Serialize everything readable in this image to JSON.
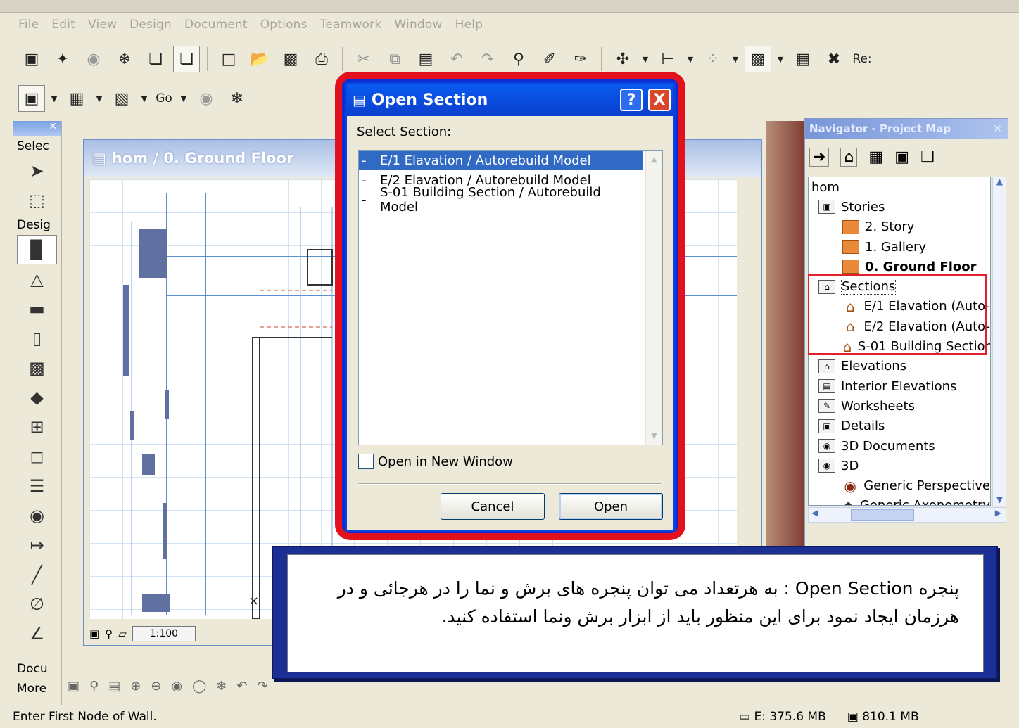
{
  "menu": [
    "File",
    "Edit",
    "View",
    "Design",
    "Document",
    "Options",
    "Teamwork",
    "Window",
    "Help"
  ],
  "toolbar1_right_label": "Re:",
  "toolbar2": {
    "go_label": "Go"
  },
  "toolbox": {
    "select_label": "Selec",
    "design_label": "Desig",
    "document_label": "Docu",
    "more_label": "More"
  },
  "plan_window": {
    "title": "hom / 0. Ground Floor",
    "scale": "1:100"
  },
  "navigator": {
    "title": "Navigator - Project Map",
    "tree": [
      {
        "label": "hom",
        "level": 0
      },
      {
        "label": "Stories",
        "level": 1
      },
      {
        "label": "2. Story",
        "level": 2
      },
      {
        "label": "1. Gallery",
        "level": 2
      },
      {
        "label": "0. Ground Floor",
        "level": 2,
        "bold": true
      },
      {
        "label": "Sections",
        "level": 1
      },
      {
        "label": "E/1 Elavation (Auto-",
        "level": 2
      },
      {
        "label": "E/2 Elavation (Auto-",
        "level": 2
      },
      {
        "label": "S-01 Building Sectior",
        "level": 2
      },
      {
        "label": "Elevations",
        "level": 1
      },
      {
        "label": "Interior Elevations",
        "level": 1
      },
      {
        "label": "Worksheets",
        "level": 1
      },
      {
        "label": "Details",
        "level": 1
      },
      {
        "label": "3D Documents",
        "level": 1
      },
      {
        "label": "3D",
        "level": 1
      },
      {
        "label": "Generic Perspective",
        "level": 2
      },
      {
        "label": "Generic Axonometry",
        "level": 2
      }
    ]
  },
  "dialog": {
    "title": "Open Section",
    "help_glyph": "?",
    "close_glyph": "X",
    "select_label": "Select Section:",
    "items": [
      {
        "bullet": "-",
        "label": "E/1 Elavation / Autorebuild Model",
        "selected": true
      },
      {
        "bullet": "-",
        "label": "E/2 Elavation / Autorebuild Model",
        "selected": false
      },
      {
        "bullet": "-",
        "label": "S-01 Building Section / Autorebuild Model",
        "selected": false
      }
    ],
    "checkbox_label": "Open in New Window",
    "checkbox_checked": false,
    "cancel_label": "Cancel",
    "open_label": "Open"
  },
  "note": {
    "text": "پنجره Open Section : به هرتعداد می توان پنجره های برش و نما را در هرجائی و در هرزمان ایجاد نمود برای این منظور باید از ابزار برش ونما استفاده کنید."
  },
  "status": {
    "message": "Enter First Node of Wall.",
    "mem_e": "E: 375.6 MB",
    "mem_total": "810.1 MB"
  },
  "colors": {
    "highlight_red": "#e3101e",
    "xp_blue": "#0a5bf2",
    "note_frame": "#1c2f95",
    "selection": "#316ac5"
  }
}
